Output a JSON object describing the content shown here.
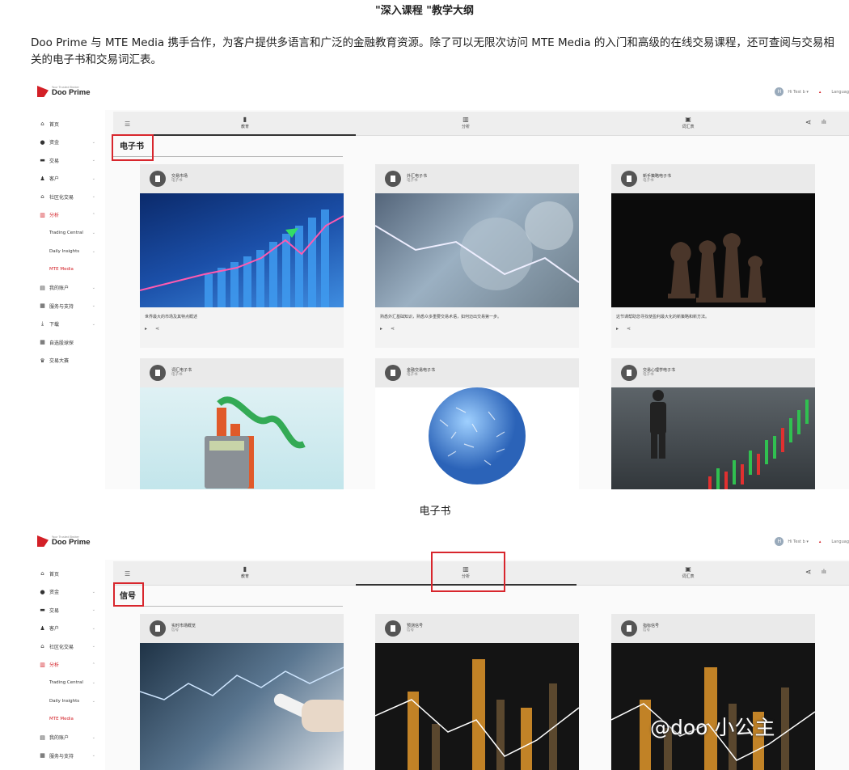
{
  "article": {
    "heading": "\"深入课程 \"教学大纲",
    "intro": "Doo Prime 与 MTE Media 携手合作，为客户提供多语言和广泛的金融教育资源。除了可以无限次访问 MTE Media 的入门和高级的在线交易课程，还可查阅与交易相关的电子书和交易词汇表。",
    "caption": "电子书",
    "watermark": "@doo 小公主"
  },
  "app": {
    "logo_tagline": "Your Trusted Broker",
    "logo_name": "Doo Prime",
    "user_label": "Hi Test b ▾",
    "avatar_letter": "H",
    "language_label": "Languag",
    "sidebar": [
      {
        "icon": "⌂",
        "label": "首页",
        "chevron": ""
      },
      {
        "icon": "●",
        "label": "资金",
        "chevron": "⌄"
      },
      {
        "icon": "▬",
        "label": "交易",
        "chevron": "⌄"
      },
      {
        "icon": "♟",
        "label": "客户",
        "chevron": "⌄"
      },
      {
        "icon": "⌂",
        "label": "社区化交易",
        "chevron": "⌄"
      },
      {
        "icon": "▥",
        "label": "分析",
        "chevron": "⌃"
      },
      {
        "icon": "",
        "label": "Trading Central",
        "chevron": "⌄"
      },
      {
        "icon": "",
        "label": "Daily Insights",
        "chevron": "⌄"
      },
      {
        "icon": "",
        "label": "MTE Media",
        "chevron": ""
      },
      {
        "icon": "▤",
        "label": "我的账户",
        "chevron": "⌄"
      },
      {
        "icon": "▦",
        "label": "服务与支持",
        "chevron": "⌄"
      },
      {
        "icon": "⤓",
        "label": "下载",
        "chevron": "⌄"
      },
      {
        "icon": "▦",
        "label": "自选股球探",
        "chevron": ""
      },
      {
        "icon": "♛",
        "label": "交易大赛",
        "chevron": ""
      }
    ],
    "tabs": [
      {
        "icon": "▮",
        "label": "教育"
      },
      {
        "icon": "▥",
        "label": "分析"
      },
      {
        "icon": "▣",
        "label": "词汇表"
      }
    ],
    "share_icon": "⋖",
    "chart_icon": "ılı"
  },
  "ebook_section": {
    "title": "电子书",
    "cards": [
      {
        "title": "交易市场",
        "sub": "电子书",
        "desc": "世界最大的市场及其特点概述"
      },
      {
        "title": "外汇电子书",
        "sub": "电子书",
        "desc": "熟悉外汇基础知识，熟悉众多重要交易术语，如何迈出交易第一步。"
      },
      {
        "title": "新手策略电子书",
        "sub": "电子书",
        "desc": "这节课帮助您寻找使盈利最大化的新策略和新方法。"
      },
      {
        "title": "词汇电子书",
        "sub": "电子书",
        "desc": ""
      },
      {
        "title": "金融交易电子书",
        "sub": "电子书",
        "desc": ""
      },
      {
        "title": "交易心理学电子书",
        "sub": "电子书",
        "desc": ""
      }
    ]
  },
  "signal_section": {
    "title": "信号",
    "cards": [
      {
        "title": "实时市场概览",
        "sub": "信号"
      },
      {
        "title": "预测信号",
        "sub": "信号"
      },
      {
        "title": "指标信号",
        "sub": "信号"
      }
    ]
  }
}
